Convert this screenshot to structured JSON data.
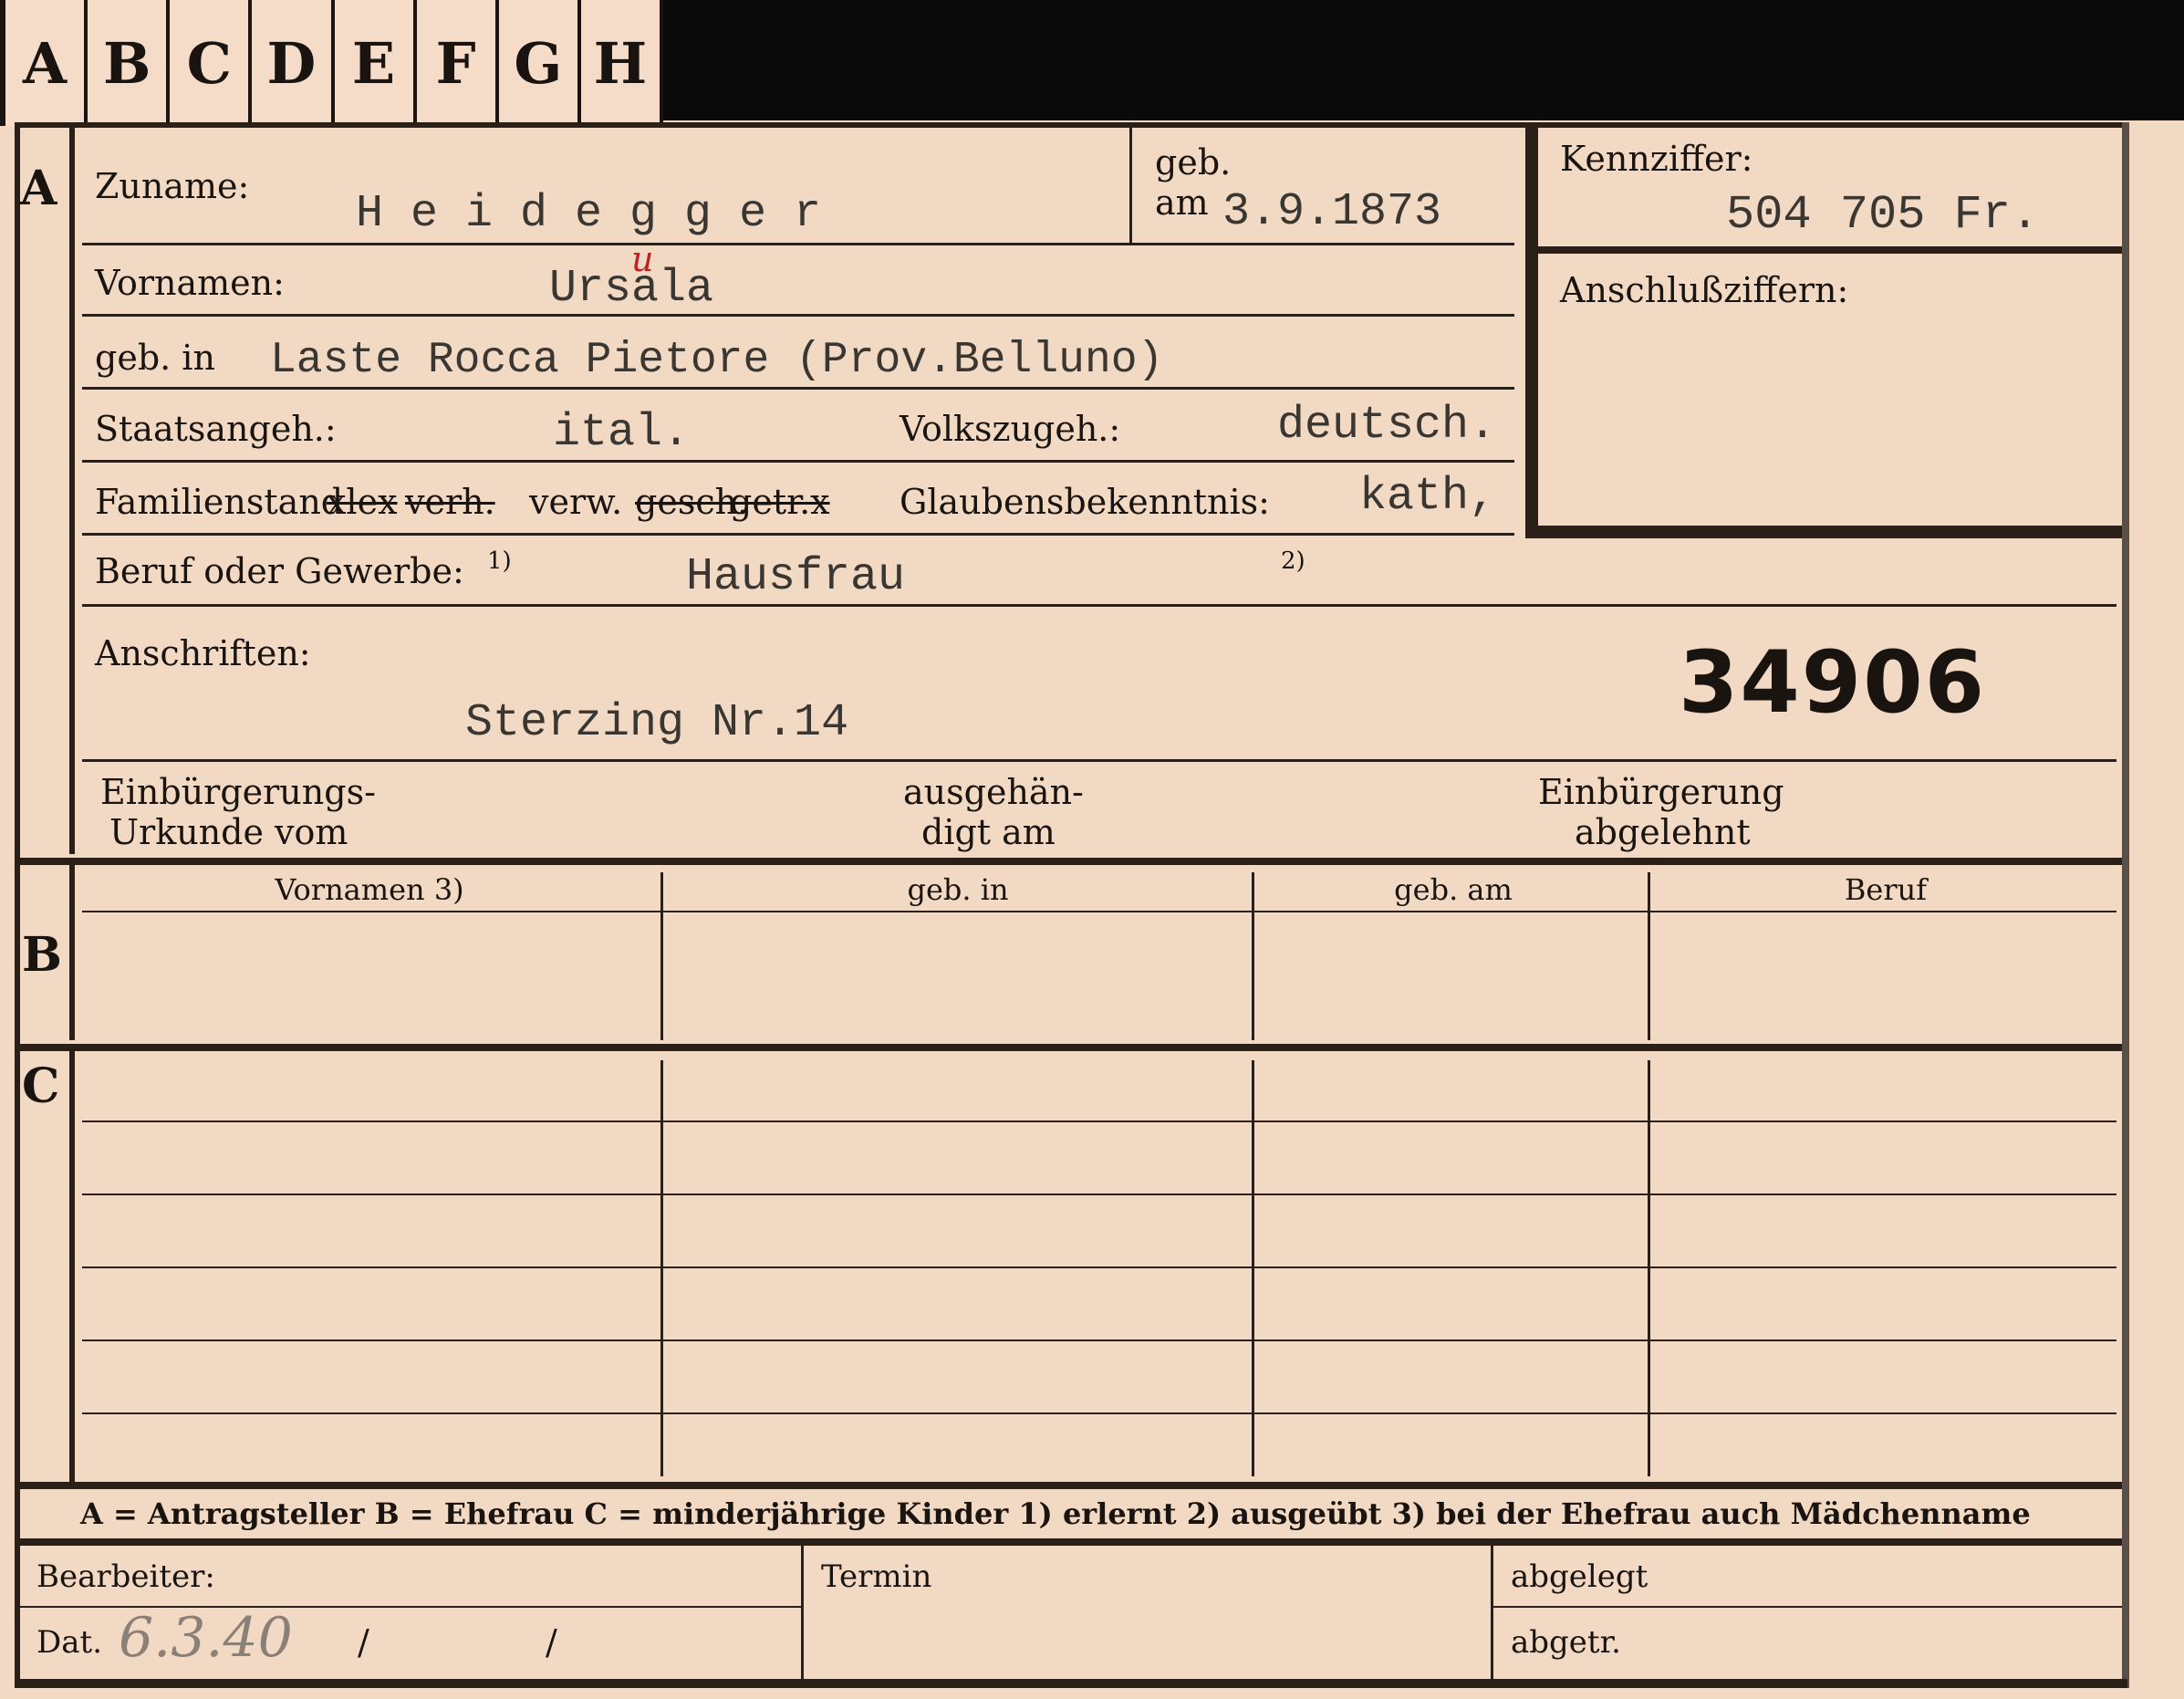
{
  "tabs": [
    "A",
    "B",
    "C",
    "D",
    "E",
    "F",
    "G",
    "H"
  ],
  "section_letters": {
    "a": "A",
    "b": "B",
    "c": "C"
  },
  "surname": {
    "label": "Zuname:",
    "value": "H e i d e g g e r"
  },
  "birth": {
    "label_geb": "geb.",
    "label_am": "am",
    "date": "3.9.1873"
  },
  "kennziffer": {
    "label": "Kennziffer:",
    "value": "504 705  Fr."
  },
  "anschluss": {
    "label": "Anschlußziffern:"
  },
  "vornamen": {
    "label": "Vornamen:",
    "value": "Ursala",
    "correction": "u"
  },
  "birthplace": {
    "label": "geb. in",
    "value": "Laste Rocca Pietore  (Prov.Belluno)"
  },
  "staat": {
    "label": "Staatsangeh.:",
    "value": "ital."
  },
  "volk": {
    "label": "Volkszugeh.:",
    "value": "deutsch."
  },
  "familienstand": {
    "label": "Familienstand",
    "struck1": "xlex",
    "struck_text1": "verh.",
    "mid": "verw.",
    "struck2": "gesch.",
    "struck_text2": "getr.x"
  },
  "glaube": {
    "label": "Glaubensbekenntnis:",
    "value": "kath,"
  },
  "beruf": {
    "label": "Beruf oder Gewerbe:",
    "fn1": "1)",
    "value": "Hausfrau",
    "fn2": "2)"
  },
  "anschriften": {
    "label": "Anschriften:",
    "value": "Sterzing Nr.14"
  },
  "stamp_number": "34906",
  "einbuergerung": {
    "urkunde_l1": "Einbürgerungs-",
    "urkunde_l2": "Urkunde vom",
    "ausg_l1": "ausgehän-",
    "ausg_l2": "digt am",
    "abgelehnt_l1": "Einbürgerung",
    "abgelehnt_l2": "abgelehnt"
  },
  "table_headers": [
    "Vornamen 3)",
    "geb. in",
    "geb. am",
    "Beruf"
  ],
  "legend": "A = Antragsteller   B = Ehefrau   C = minderjährige Kinder   1) erlernt   2) ausgeübt   3) bei der Ehefrau auch Mädchenname",
  "footer": {
    "bearbeiter": "Bearbeiter:",
    "termin": "Termin",
    "abgelegt": "abgelegt",
    "dat": "Dat.",
    "date_hand": "6.3.40",
    "slash1": "/",
    "slash2": "/",
    "abgetr": "abgetr."
  }
}
